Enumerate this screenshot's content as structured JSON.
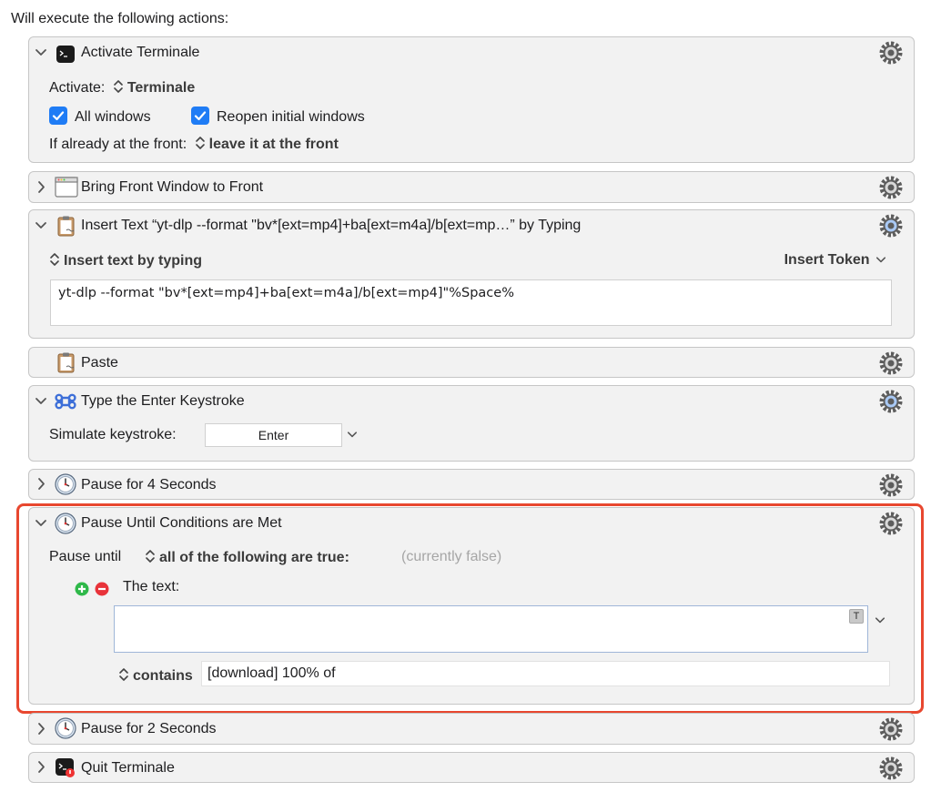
{
  "header": {
    "title": "Will execute the following actions:"
  },
  "actions": [
    {
      "title": "Activate Terminale",
      "icon": "terminal-icon",
      "activate_label": "Activate:",
      "activate_value": "Terminale",
      "checkbox_all_windows": "All windows",
      "checkbox_reopen": "Reopen initial windows",
      "front_label": "If already at the front:",
      "front_value": "leave it at the front"
    },
    {
      "title": "Bring Front Window to Front",
      "icon": "window-icon"
    },
    {
      "title": "Insert Text “yt-dlp --format \"bv*[ext=mp4]+ba[ext=m4a]/b[ext=mp…” by Typing",
      "icon": "clipboard-icon",
      "mode": "Insert text by typing",
      "token_button": "Insert Token",
      "text_value": "yt-dlp --format \"bv*[ext=mp4]+ba[ext=m4a]/b[ext=mp4]\"%Space%"
    },
    {
      "title": "Paste",
      "icon": "clipboard-icon"
    },
    {
      "title": "Type the Enter Keystroke",
      "icon": "command-key-icon",
      "simulate_label": "Simulate keystroke:",
      "keystroke": "Enter"
    },
    {
      "title": "Pause for 4 Seconds",
      "icon": "clock-icon"
    },
    {
      "title": "Pause Until Conditions are Met",
      "icon": "clock-icon",
      "pause_label": "Pause until",
      "pause_value": "all of the following are true:",
      "status": "(currently false)",
      "condition_label": "The text:",
      "token_badge": "T",
      "contains_label": "contains",
      "contains_value": "[download] 100% of"
    },
    {
      "title": "Pause for 2 Seconds",
      "icon": "clock-icon"
    },
    {
      "title": "Quit Terminale",
      "icon": "terminal-icon"
    }
  ],
  "colors": {
    "accent": "#1f7cf5",
    "highlight": "#e8472f",
    "panel_bg": "#f2f2f2",
    "add_green": "#2fb84a",
    "remove_red": "#e8333a"
  }
}
